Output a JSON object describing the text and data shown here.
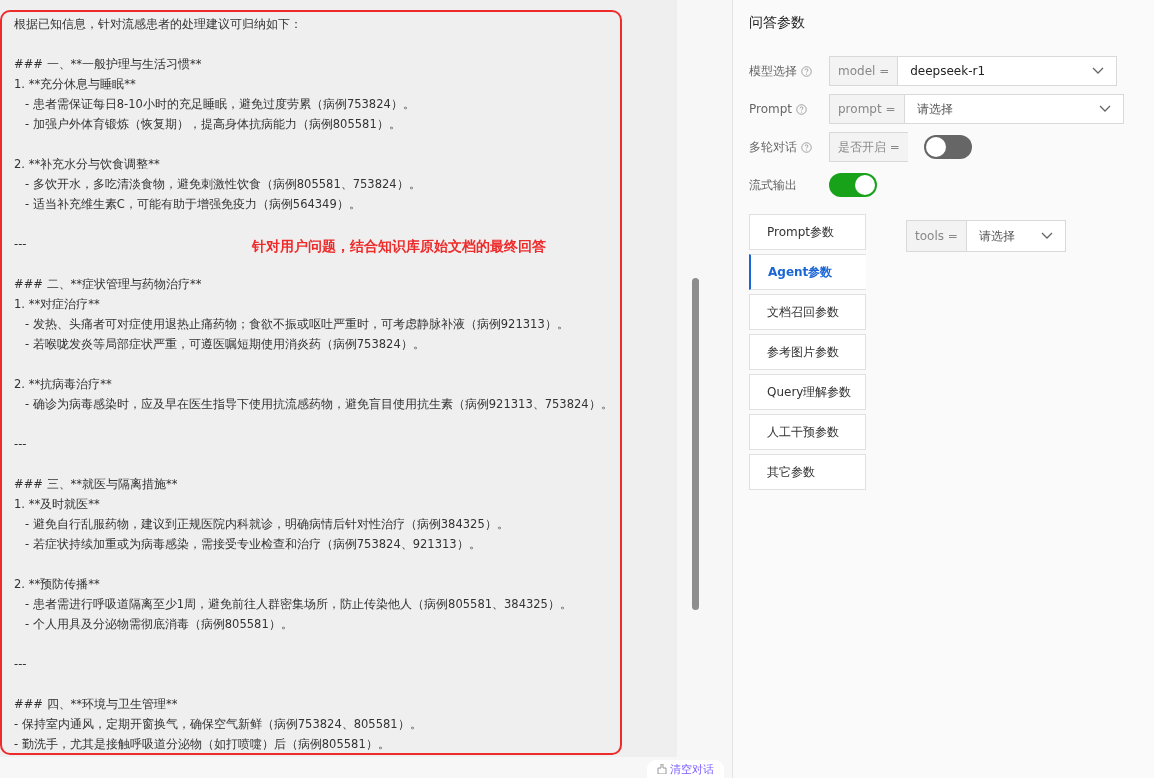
{
  "answer": {
    "blocks": [
      [
        {
          "kind": "line",
          "text": "根据已知信息，针对流感患者的处理建议可归纳如下："
        }
      ],
      [
        {
          "kind": "line",
          "text": "### 一、**一般护理与生活习惯**"
        },
        {
          "kind": "line",
          "text": "1. **充分休息与睡眠**"
        },
        {
          "kind": "sub",
          "text": "- 患者需保证每日8-10小时的充足睡眠，避免过度劳累（病例753824）。"
        },
        {
          "kind": "sub",
          "text": "- 加强户外体育锻炼（恢复期），提高身体抗病能力（病例805581）。"
        }
      ],
      [
        {
          "kind": "line",
          "text": "2. **补充水分与饮食调整**"
        },
        {
          "kind": "sub",
          "text": "- 多饮开水，多吃清淡食物，避免刺激性饮食（病例805581、753824）。"
        },
        {
          "kind": "sub",
          "text": "- 适当补充维生素C，可能有助于增强免疫力（病例564349）。"
        }
      ],
      [
        {
          "kind": "line",
          "text": "---"
        }
      ],
      [
        {
          "kind": "line",
          "text": "### 二、**症状管理与药物治疗**"
        },
        {
          "kind": "line",
          "text": "1. **对症治疗**"
        },
        {
          "kind": "sub",
          "text": "- 发热、头痛者可对症使用退热止痛药物；食欲不振或呕吐严重时，可考虑静脉补液（病例921313）。"
        },
        {
          "kind": "sub",
          "text": "- 若喉咙发炎等局部症状严重，可遵医嘱短期使用消炎药（病例753824）。"
        }
      ],
      [
        {
          "kind": "line",
          "text": "2. **抗病毒治疗**"
        },
        {
          "kind": "sub",
          "text": "- 确诊为病毒感染时，应及早在医生指导下使用抗流感药物，避免盲目使用抗生素（病例921313、753824）。"
        }
      ],
      [
        {
          "kind": "line",
          "text": "---"
        }
      ],
      [
        {
          "kind": "line",
          "text": "### 三、**就医与隔离措施**"
        },
        {
          "kind": "line",
          "text": "1. **及时就医**"
        },
        {
          "kind": "sub",
          "text": "- 避免自行乱服药物，建议到正规医院内科就诊，明确病情后针对性治疗（病例384325）。"
        },
        {
          "kind": "sub",
          "text": "- 若症状持续加重或为病毒感染，需接受专业检查和治疗（病例753824、921313）。"
        }
      ],
      [
        {
          "kind": "line",
          "text": "2. **预防传播**"
        },
        {
          "kind": "sub",
          "text": "- 患者需进行呼吸道隔离至少1周，避免前往人群密集场所，防止传染他人（病例805581、384325）。"
        },
        {
          "kind": "sub",
          "text": "- 个人用具及分泌物需彻底消毒（病例805581）。"
        }
      ],
      [
        {
          "kind": "line",
          "text": "---"
        }
      ],
      [
        {
          "kind": "line",
          "text": "### 四、**环境与卫生管理**"
        },
        {
          "kind": "line",
          "text": "- 保持室内通风，定期开窗换气，确保空气新鲜（病例753824、805581）。"
        },
        {
          "kind": "line",
          "text": "- 勤洗手，尤其是接触呼吸道分泌物（如打喷嚏）后（病例805581）。"
        }
      ]
    ],
    "annotation": "针对用户问题，结合知识库原始文档的最终回答"
  },
  "clear_button": "清空对话",
  "settings": {
    "title": "问答参数",
    "fields": [
      {
        "kind": "select",
        "label": "模型选择",
        "help": true,
        "addon": "model =",
        "value": "deepseek-r1"
      },
      {
        "kind": "select",
        "label": "Prompt",
        "help": true,
        "addon": "prompt =",
        "placeholder": "请选择"
      },
      {
        "kind": "switch",
        "label": "多轮对话",
        "help": true,
        "addon": "是否开启 =",
        "on": false
      },
      {
        "kind": "switch",
        "label": "流式输出",
        "help": false,
        "on": true
      }
    ],
    "tabs": [
      {
        "label": "Prompt参数",
        "selected": false
      },
      {
        "label": "Agent参数",
        "selected": true
      },
      {
        "label": "文档召回参数",
        "selected": false
      },
      {
        "label": "参考图片参数",
        "selected": false
      },
      {
        "label": "Query理解参数",
        "selected": false
      },
      {
        "label": "人工干预参数",
        "selected": false
      },
      {
        "label": "其它参数",
        "selected": false
      }
    ],
    "tab_field": {
      "addon": "tools =",
      "placeholder": "请选择"
    }
  }
}
